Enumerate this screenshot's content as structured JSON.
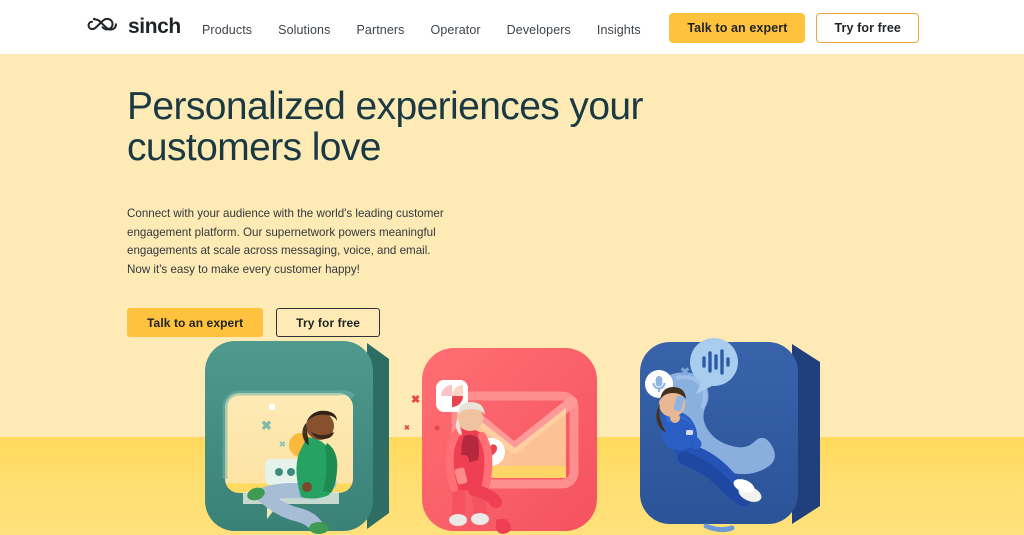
{
  "site": {
    "brand_name": "sinch",
    "logo_icon": "sinch-infinity-logo"
  },
  "header": {
    "nav_items": [
      {
        "label": "Products"
      },
      {
        "label": "Solutions"
      },
      {
        "label": "Partners"
      },
      {
        "label": "Operator"
      },
      {
        "label": "Developers"
      },
      {
        "label": "Insights"
      }
    ],
    "primary_cta": "Talk to an expert",
    "secondary_cta": "Try for free"
  },
  "hero": {
    "title": "Personalized experiences your customers love",
    "subtitle": "Connect with your audience with the world's leading customer engagement platform. Our supernetwork powers meaningful engagements at scale across messaging, voice, and email. Now it's easy to make every customer happy!",
    "primary_cta": "Talk to an expert",
    "secondary_cta": "Try for free"
  },
  "illustration": {
    "cards": [
      {
        "name": "messaging-chat-card",
        "channel": "messaging",
        "icon": "chat-bubble-icon",
        "color": "#3e8b80",
        "badge": "typing-dots-indicator"
      },
      {
        "name": "email-envelope-card",
        "channel": "email",
        "icon": "envelope-icon",
        "color": "#f9606b",
        "badge": "heart-icon"
      },
      {
        "name": "voice-phone-card",
        "channel": "voice",
        "icon": "phone-handset-icon",
        "color": "#2e5ba6",
        "badge": "voice-waveform-icon"
      }
    ]
  },
  "colors": {
    "hero_background": "#fdeab5",
    "floor": "#ffd95c",
    "accent_amber": "#ffc23f",
    "heading": "#1b3942",
    "teal": "#3e8b80",
    "coral": "#f9606b",
    "blue": "#2e5ba6"
  }
}
